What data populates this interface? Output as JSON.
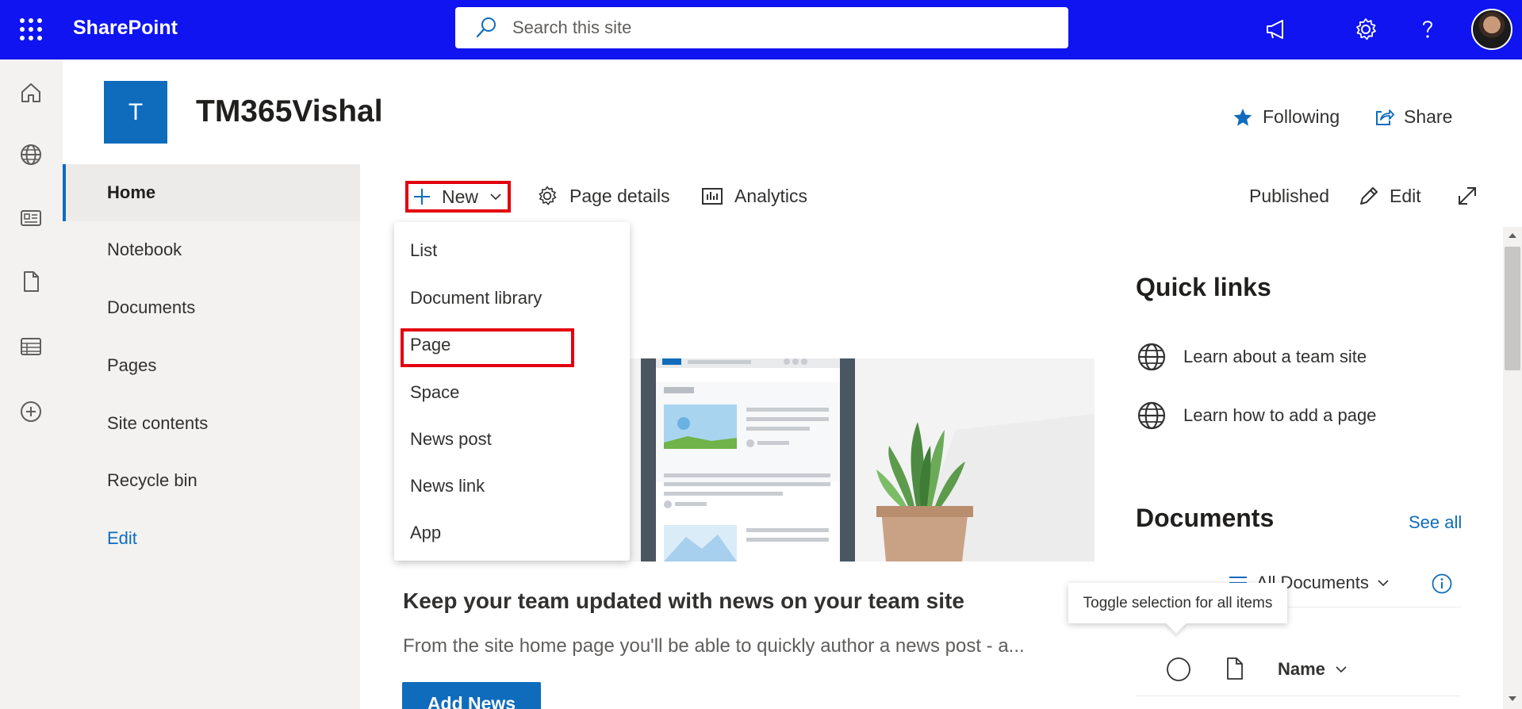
{
  "suite": {
    "brand": "SharePoint",
    "search_placeholder": "Search this site"
  },
  "site": {
    "logo_letter": "T",
    "title": "TM365Vishal",
    "following_label": "Following",
    "share_label": "Share"
  },
  "leftnav": {
    "items": [
      {
        "label": "Home"
      },
      {
        "label": "Notebook"
      },
      {
        "label": "Documents"
      },
      {
        "label": "Pages"
      },
      {
        "label": "Site contents"
      },
      {
        "label": "Recycle bin"
      },
      {
        "label": "Edit"
      }
    ]
  },
  "commandbar": {
    "new_label": "New",
    "page_details_label": "Page details",
    "analytics_label": "Analytics",
    "status_label": "Published",
    "edit_label": "Edit"
  },
  "new_menu": {
    "items": [
      {
        "label": "List"
      },
      {
        "label": "Document library"
      },
      {
        "label": "Page"
      },
      {
        "label": "Space"
      },
      {
        "label": "News post"
      },
      {
        "label": "News link"
      },
      {
        "label": "App"
      }
    ]
  },
  "news": {
    "title": "Keep your team updated with news on your team site",
    "description": "From the site home page you'll be able to quickly author a news post - a...",
    "add_news_label": "Add News"
  },
  "quick_links": {
    "title": "Quick links",
    "items": [
      {
        "label": "Learn about a team site"
      },
      {
        "label": "Learn how to add a page"
      }
    ]
  },
  "documents": {
    "title": "Documents",
    "see_all_label": "See all",
    "view_label": "All Documents",
    "tooltip": "Toggle selection for all items",
    "name_column": "Name"
  },
  "colors": {
    "suite_bar": "#0f14f0",
    "accent": "#0f6cbd",
    "highlight_box": "#e3000f"
  }
}
